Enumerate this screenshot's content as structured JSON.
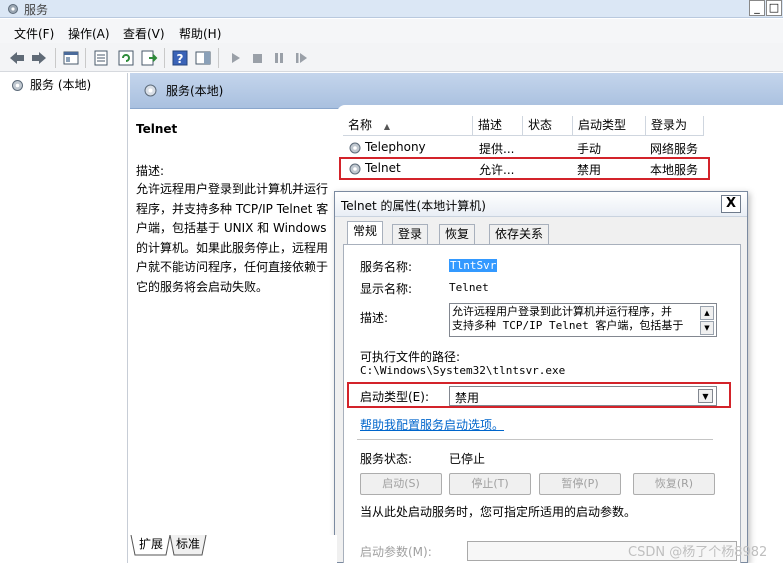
{
  "window": {
    "title": "服务"
  },
  "menu": [
    "文件(F)",
    "操作(A)",
    "查看(V)",
    "帮助(H)"
  ],
  "toolbar": {
    "icons": [
      "back-arrow-icon",
      "forward-arrow-icon",
      "show-hide-console-tree-icon",
      "properties-icon",
      "refresh-icon",
      "export-list-icon",
      "help-icon",
      "action-pane-icon",
      "start-service-icon",
      "stop-service-icon",
      "pause-service-icon",
      "restart-service-icon"
    ]
  },
  "tree": {
    "root": "服务 (本地)"
  },
  "panel": {
    "header": "服务(本地)"
  },
  "description_pane": {
    "service_name": "Telnet",
    "label": "描述:",
    "lines": [
      "允许远程用户登录到此计算机并运行",
      "程序，并支持多种 TCP/IP Telnet 客",
      "户端，包括基于 UNIX 和 Windows",
      "的计算机。如果此服务停止，远程用",
      "户就不能访问程序，任何直接依赖于",
      "它的服务将会启动失败。"
    ]
  },
  "services_table": {
    "columns": [
      "名称",
      "描述",
      "状态",
      "启动类型",
      "登录为"
    ],
    "rows": [
      {
        "name": "Telephony",
        "desc": "提供...",
        "status": "",
        "startup": "手动",
        "logon": "网络服务"
      },
      {
        "name": "Telnet",
        "desc": "允许...",
        "status": "",
        "startup": "禁用",
        "logon": "本地服务"
      }
    ]
  },
  "dialog": {
    "title": "Telnet 的属性(本地计算机)",
    "close_label": "X",
    "tabs": [
      "常规",
      "登录",
      "恢复",
      "依存关系"
    ],
    "service_name_label": "服务名称:",
    "service_name": "TlntSvr",
    "display_name_label": "显示名称:",
    "display_name": "Telnet",
    "description_label": "描述:",
    "description_lines": [
      "允许远程用户登录到此计算机并运行程序，并",
      "支持多种 TCP/IP Telnet 客户端，包括基于"
    ],
    "path_label": "可执行文件的路径:",
    "path": "C:\\Windows\\System32\\tlntsvr.exe",
    "startup_type_label": "启动类型(E):",
    "startup_type": "禁用",
    "help_link": "帮助我配置服务启动选项。",
    "status_label": "服务状态:",
    "status": "已停止",
    "buttons": {
      "start": "启动(S)",
      "stop": "停止(T)",
      "pause": "暂停(P)",
      "resume": "恢复(R)"
    },
    "hint": "当从此处启动服务时，您可指定所适用的启动参数。",
    "params_label": "启动参数(M):",
    "params_value": ""
  },
  "bottom_tabs": [
    "扩展",
    "标准"
  ],
  "watermark": "CSDN @杨了个杨8982",
  "colors": {
    "highlight_border": "#d3232a",
    "selection": "#3399ff",
    "link": "#0066cc"
  }
}
